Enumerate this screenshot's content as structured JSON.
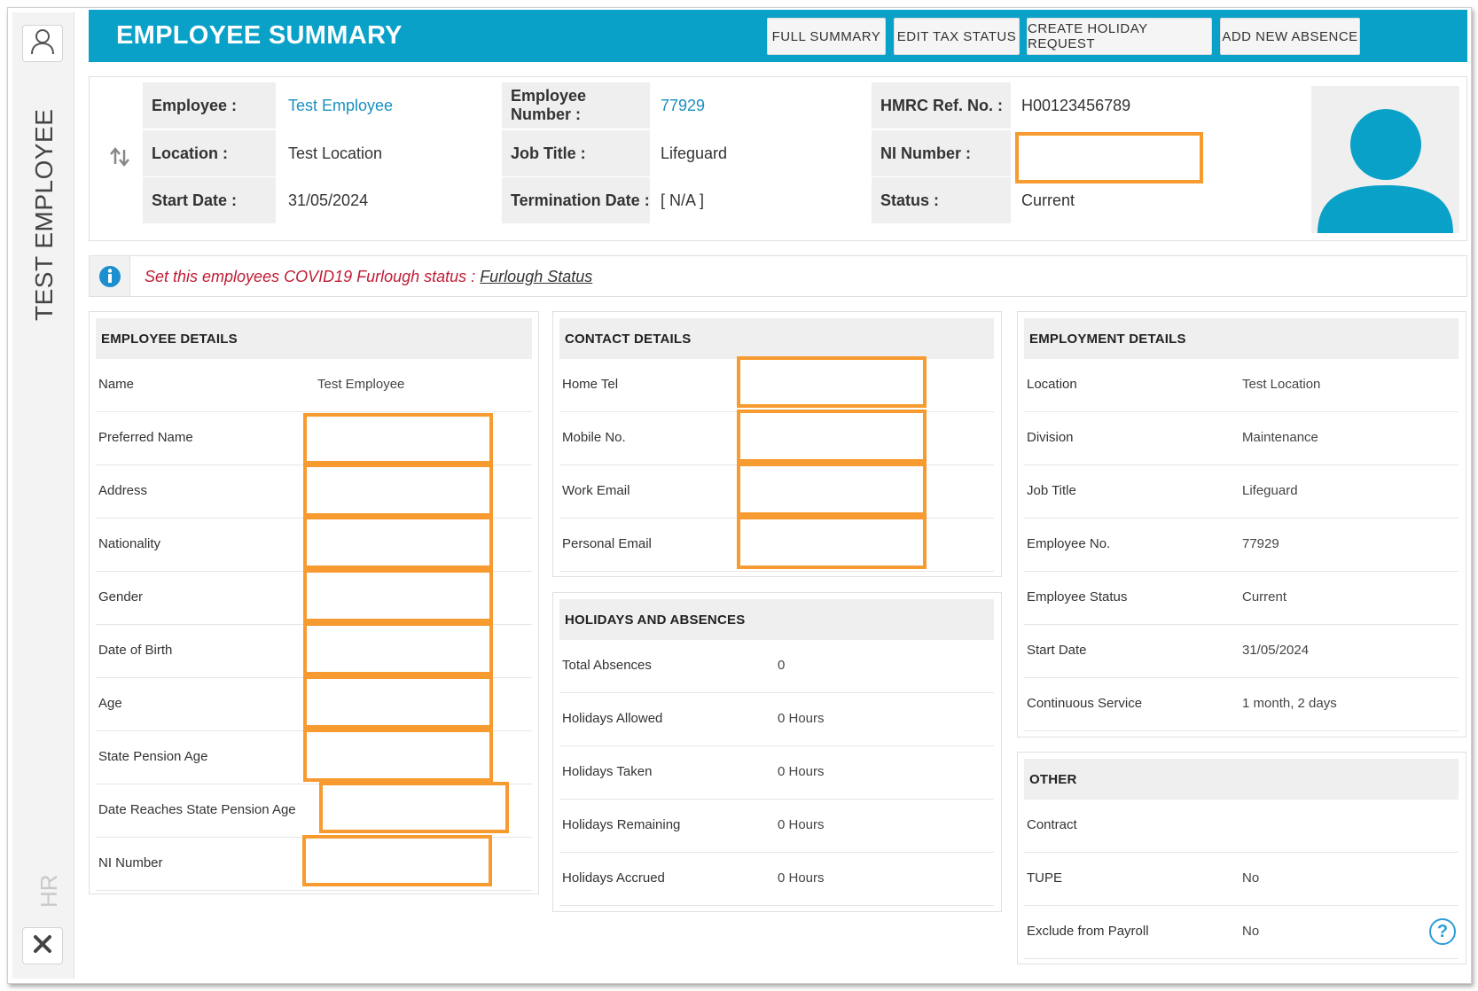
{
  "sidebar": {
    "title": "TEST EMPLOYEE",
    "section": "HR",
    "user_icon": "user-icon",
    "close_icon": "close-icon"
  },
  "header": {
    "title": "EMPLOYEE SUMMARY",
    "buttons": [
      "FULL SUMMARY",
      "EDIT TAX STATUS",
      "CREATE HOLIDAY REQUEST",
      "ADD NEW ABSENCE"
    ],
    "color": "#0aa1c9"
  },
  "summary": {
    "employee_label": "Employee :",
    "employee_value": "Test Employee",
    "location_label": "Location :",
    "location_value": "Test Location",
    "start_label": "Start Date :",
    "start_value": "31/05/2024",
    "empno_label": "Employee Number :",
    "empno_value": "77929",
    "job_label": "Job Title :",
    "job_value": "Lifeguard",
    "term_label": "Termination Date :",
    "term_value": "[ N/A ]",
    "hmrc_label": "HMRC Ref. No. :",
    "hmrc_value": "H00123456789",
    "ni_label": "NI Number :",
    "ni_value": "",
    "status_label": "Status :",
    "status_value": "Current"
  },
  "info": {
    "message": "Set this employees COVID19 Furlough status : ",
    "link": "Furlough Status"
  },
  "employee_details": {
    "title": "EMPLOYEE DETAILS",
    "rows": [
      {
        "label": "Name",
        "value": "Test Employee"
      },
      {
        "label": "Preferred Name",
        "value": ""
      },
      {
        "label": "Address",
        "value": ""
      },
      {
        "label": "Nationality",
        "value": ""
      },
      {
        "label": "Gender",
        "value": ""
      },
      {
        "label": "Date of Birth",
        "value": ""
      },
      {
        "label": "Age",
        "value": ""
      },
      {
        "label": "State Pension Age",
        "value": ""
      },
      {
        "label": "Date Reaches State Pension Age",
        "value": ""
      },
      {
        "label": "NI Number",
        "value": ""
      }
    ]
  },
  "contact_details": {
    "title": "CONTACT DETAILS",
    "rows": [
      {
        "label": "Home Tel",
        "value": ""
      },
      {
        "label": "Mobile No.",
        "value": ""
      },
      {
        "label": "Work Email",
        "value": ""
      },
      {
        "label": "Personal Email",
        "value": ""
      }
    ]
  },
  "holidays": {
    "title": "HOLIDAYS AND ABSENCES",
    "rows": [
      {
        "label": "Total Absences",
        "value": "0"
      },
      {
        "label": "Holidays Allowed",
        "value": "0 Hours"
      },
      {
        "label": "Holidays Taken",
        "value": "0 Hours"
      },
      {
        "label": "Holidays Remaining",
        "value": "0 Hours"
      },
      {
        "label": "Holidays Accrued",
        "value": "0 Hours"
      }
    ]
  },
  "employment_details": {
    "title": "EMPLOYMENT DETAILS",
    "rows": [
      {
        "label": "Location",
        "value": "Test Location"
      },
      {
        "label": "Division",
        "value": "Maintenance"
      },
      {
        "label": "Job Title",
        "value": "Lifeguard"
      },
      {
        "label": "Employee No.",
        "value": "77929"
      },
      {
        "label": "Employee Status",
        "value": "Current"
      },
      {
        "label": "Start Date",
        "value": "31/05/2024"
      },
      {
        "label": "Continuous Service",
        "value": "1 month, 2 days"
      }
    ]
  },
  "other": {
    "title": "OTHER",
    "rows": [
      {
        "label": "Contract",
        "value": ""
      },
      {
        "label": "TUPE",
        "value": "No"
      },
      {
        "label": "Exclude from Payroll",
        "value": "No"
      }
    ]
  },
  "help": "?",
  "colors": {
    "accent": "#0aa1c9",
    "link": "#1a8fc0",
    "redaction": "#f79a2f",
    "alert": "#c01c35"
  }
}
